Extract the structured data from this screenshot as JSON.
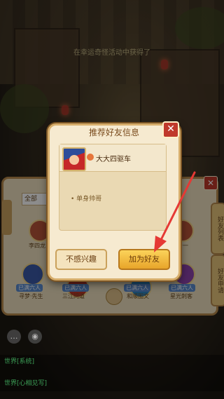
{
  "background": {
    "top_message": "在幸运奇怪活动中获得了",
    "friend_panel": {
      "close_glyph": "✕",
      "filter_select": "全部",
      "side_tabs": [
        "好友列表",
        "好友申请"
      ],
      "friends": [
        {
          "name": "李四龙",
          "badge": ""
        },
        {
          "name": "一号一",
          "badge": ""
        },
        {
          "name": "寻梦·先生",
          "badge": "已满六人"
        },
        {
          "name": "三江问道",
          "badge": "已满六人"
        },
        {
          "name": "和顺图文",
          "badge": "已满六人"
        },
        {
          "name": "星光刺客",
          "badge": "已满六人"
        }
      ]
    },
    "chat_lines": [
      "世界[系统]",
      "世界[心相见写]"
    ]
  },
  "dialog": {
    "title": "推荐好友信息",
    "close_glyph": "✕",
    "player_name": "大大四驱车",
    "signature": "• 单身帅哥",
    "not_interested_button": "不感兴趣",
    "add_friend_button": "加为好友"
  },
  "colors": {
    "accent_red": "#c0392b",
    "arrow": "#e53935",
    "gold_button": "#f5c24a"
  }
}
